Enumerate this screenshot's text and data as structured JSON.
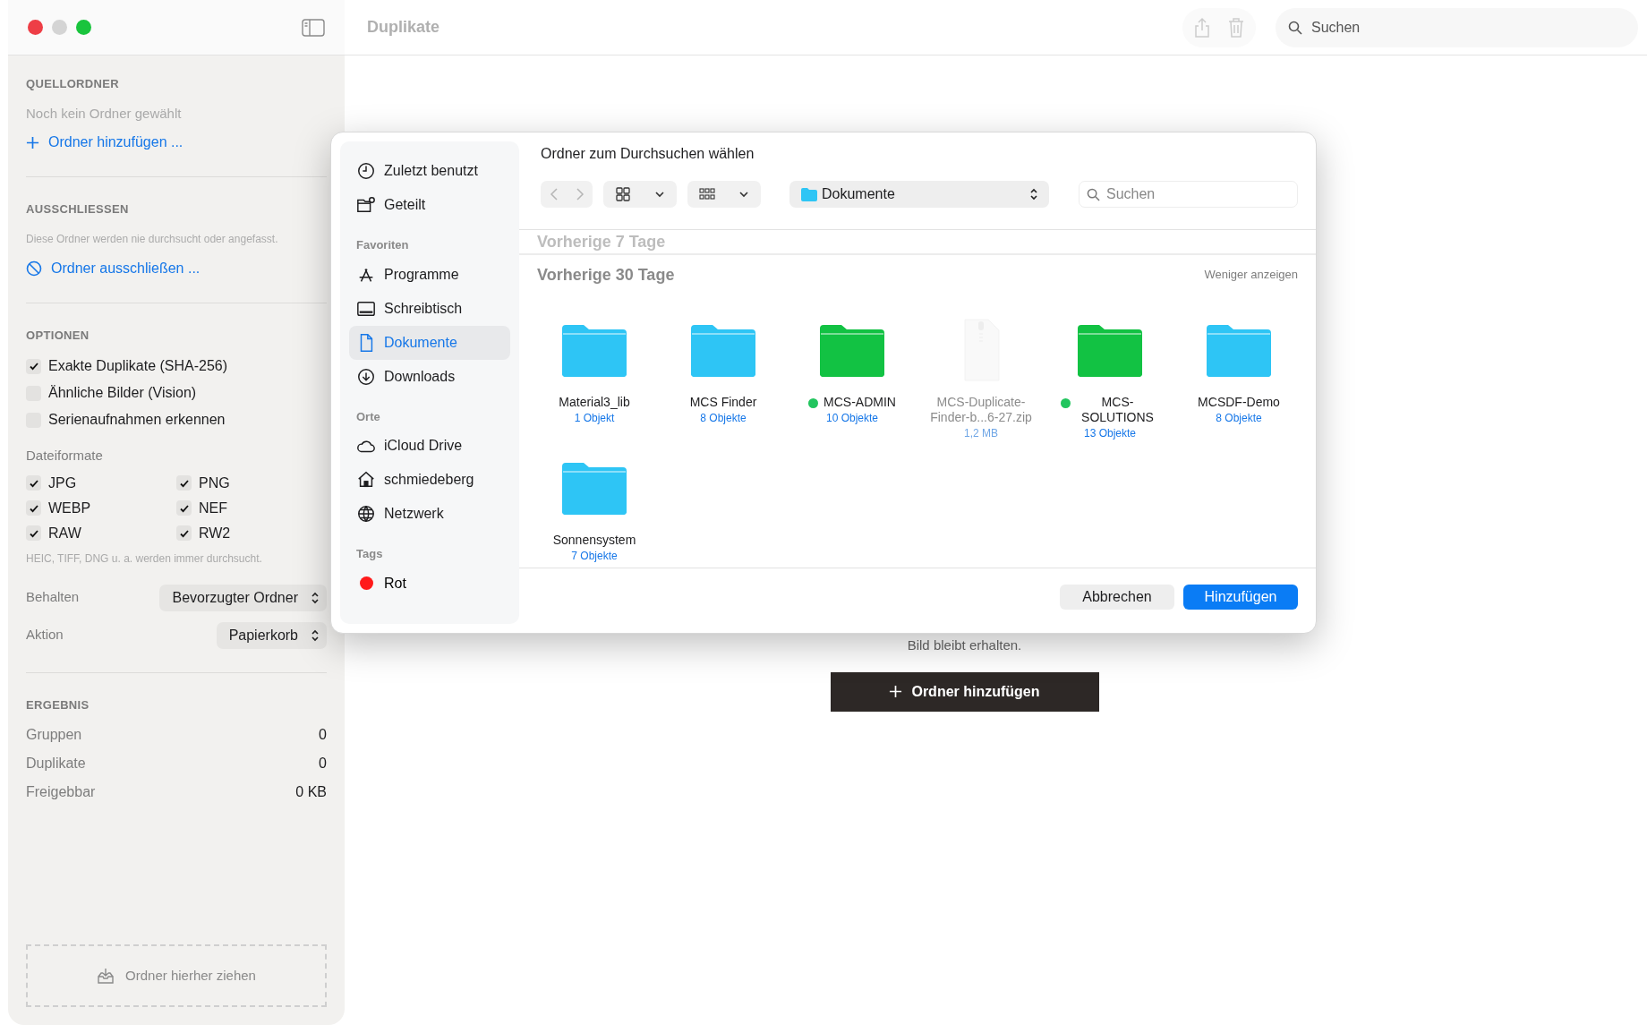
{
  "window": {
    "title": "Duplikate"
  },
  "toolbar": {
    "search": {
      "placeholder": "Suchen"
    }
  },
  "sidebar": {
    "source": {
      "heading": "QUELLORDNER",
      "empty": "Noch kein Ordner gewählt",
      "add_link": "Ordner hinzufügen ..."
    },
    "exclude": {
      "heading": "AUSSCHLIESSEN",
      "note": "Diese Ordner werden nie durchsucht oder angefasst.",
      "link": "Ordner ausschließen ..."
    },
    "options": {
      "heading": "OPTIONEN",
      "items": [
        {
          "label": "Exakte Duplikate (SHA-256)",
          "checked": true
        },
        {
          "label": "Ähnliche Bilder (Vision)",
          "checked": false
        },
        {
          "label": "Serienaufnahmen erkennen",
          "checked": false
        }
      ]
    },
    "formats": {
      "heading": "Dateiformate",
      "items": [
        {
          "label": "JPG",
          "checked": true
        },
        {
          "label": "PNG",
          "checked": true
        },
        {
          "label": "WEBP",
          "checked": true
        },
        {
          "label": "NEF",
          "checked": true
        },
        {
          "label": "RAW",
          "checked": true
        },
        {
          "label": "RW2",
          "checked": true
        }
      ],
      "note": "HEIC, TIFF, DNG u. a. werden immer durchsucht."
    },
    "selects": [
      {
        "label": "Behalten",
        "value": "Bevorzugter Ordner"
      },
      {
        "label": "Aktion",
        "value": "Papierkorb"
      }
    ],
    "result": {
      "heading": "ERGEBNIS",
      "rows": [
        {
          "label": "Gruppen",
          "value": "0"
        },
        {
          "label": "Duplikate",
          "value": "0"
        },
        {
          "label": "Freigebbar",
          "value": "0 KB"
        }
      ]
    },
    "drop_zone": "Ordner hierher ziehen"
  },
  "main": {
    "hint": "Bild bleibt erhalten.",
    "add_button": "Ordner hinzufügen"
  },
  "dialog": {
    "title": "Ordner zum Durchsuchen wählen",
    "sidebar": [
      {
        "kind": "item",
        "label": "Zuletzt benutzt",
        "selected": false
      },
      {
        "kind": "item",
        "label": "Geteilt",
        "selected": false
      },
      {
        "kind": "header",
        "label": "Favoriten"
      },
      {
        "kind": "item",
        "label": "Programme",
        "selected": false
      },
      {
        "kind": "item",
        "label": "Schreibtisch",
        "selected": false
      },
      {
        "kind": "item",
        "label": "Dokumente",
        "selected": true
      },
      {
        "kind": "item",
        "label": "Downloads",
        "selected": false
      },
      {
        "kind": "header",
        "label": "Orte"
      },
      {
        "kind": "item",
        "label": "iCloud Drive",
        "selected": false
      },
      {
        "kind": "item",
        "label": "schmiedeberg",
        "selected": false
      },
      {
        "kind": "item",
        "label": "Netzwerk",
        "selected": false
      },
      {
        "kind": "header",
        "label": "Tags"
      },
      {
        "kind": "tag",
        "label": "Rot",
        "color": "#ff1a1a",
        "selected": false
      }
    ],
    "location": "Dokumente",
    "search": {
      "placeholder": "Suchen"
    },
    "sections": [
      {
        "title": "Vorherige 7 Tage"
      },
      {
        "title": "Vorherige 30 Tage",
        "action": "Weniger anzeigen"
      }
    ],
    "files": [
      {
        "kind": "folder",
        "name": "Material3_lib",
        "info": "1 Objekt",
        "color": "#2ec5f5",
        "disabled": false
      },
      {
        "kind": "folder",
        "name": "MCS Finder",
        "info": "8 Objekte",
        "color": "#2ec5f5",
        "disabled": false
      },
      {
        "kind": "folder",
        "name": "MCS-ADMIN",
        "info": "10 Objekte",
        "color": "#12c243",
        "tag": {
          "color": "#22c55e"
        },
        "disabled": false
      },
      {
        "kind": "zip",
        "name": "MCS-Duplicate-Finder-b...6-27.zip",
        "info": "1,2 MB",
        "disabled": true
      },
      {
        "kind": "folder",
        "name": "MCS-SOLUTIONS",
        "info": "13 Objekte",
        "color": "#12c243",
        "tag": {
          "color": "#22c55e"
        },
        "disabled": false
      },
      {
        "kind": "folder",
        "name": "MCSDF-Demo",
        "info": "8 Objekte",
        "color": "#2ec5f5",
        "disabled": false
      },
      {
        "kind": "folder",
        "name": "Sonnensystem",
        "info": "7 Objekte",
        "color": "#2ec5f5",
        "disabled": false
      }
    ],
    "buttons": [
      {
        "kind": "secondary",
        "label": "Abbrechen"
      },
      {
        "kind": "primary",
        "label": "Hinzufügen"
      }
    ]
  }
}
